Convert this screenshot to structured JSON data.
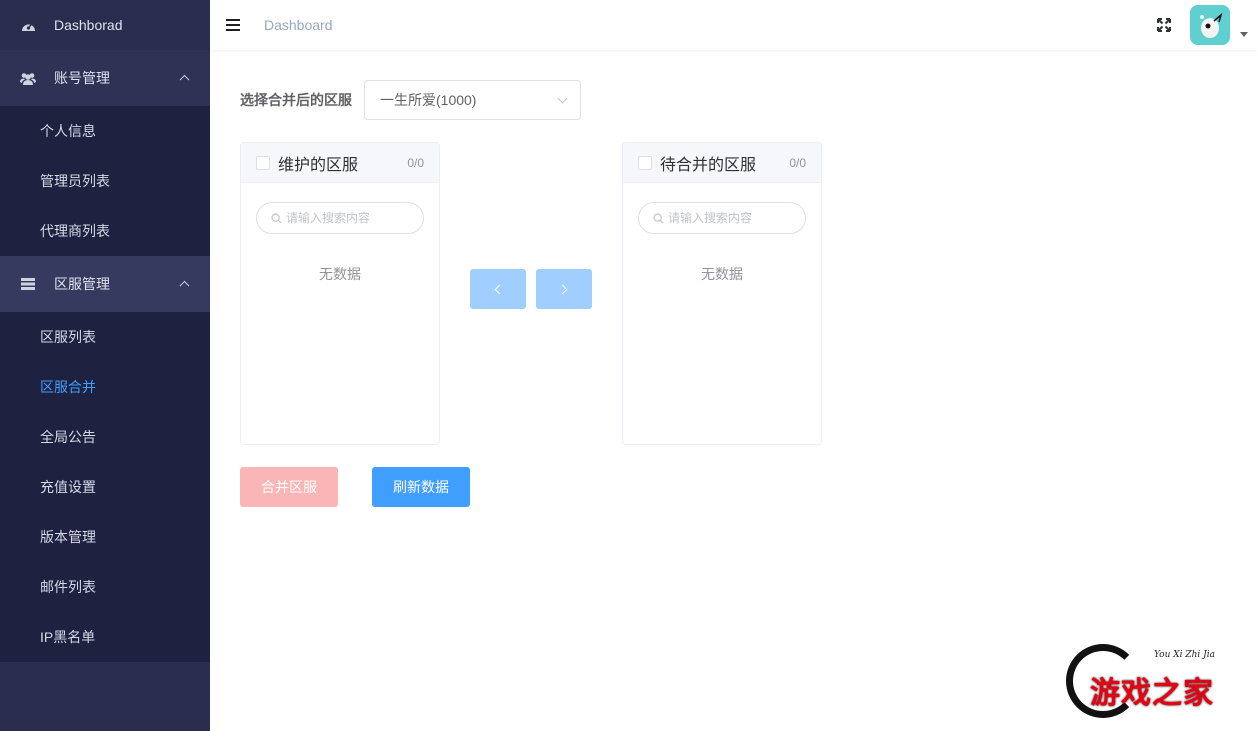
{
  "sidebar": {
    "top_item": "Dashborad",
    "groups": [
      {
        "label": "账号管理",
        "items": [
          "个人信息",
          "管理员列表",
          "代理商列表"
        ]
      },
      {
        "label": "区服管理",
        "items": [
          "区服列表",
          "区服合并",
          "全局公告",
          "充值设置",
          "版本管理",
          "邮件列表",
          "IP黑名单"
        ]
      }
    ],
    "active_item": "区服合并"
  },
  "header": {
    "breadcrumb": "Dashboard"
  },
  "form": {
    "label": "选择合并后的区服",
    "selected_server": "一生所爱(1000)"
  },
  "transfer": {
    "left": {
      "title": "维护的区服",
      "count": "0/0",
      "search_placeholder": "请输入搜索内容",
      "empty_text": "无数据"
    },
    "right": {
      "title": "待合并的区服",
      "count": "0/0",
      "search_placeholder": "请输入搜索内容",
      "empty_text": "无数据"
    }
  },
  "buttons": {
    "merge": "合并区服",
    "refresh": "刷新数据"
  },
  "watermark": {
    "script_text": "You Xi Zhi Jia",
    "text": "游戏之家"
  },
  "colors": {
    "sidebar_bg": "#2b2d4e",
    "sidebar_sub_bg": "#1f2140",
    "active": "#409eff",
    "primary": "#409eff",
    "primary_disabled": "#a0cfff",
    "danger_disabled": "#fab6b6"
  }
}
